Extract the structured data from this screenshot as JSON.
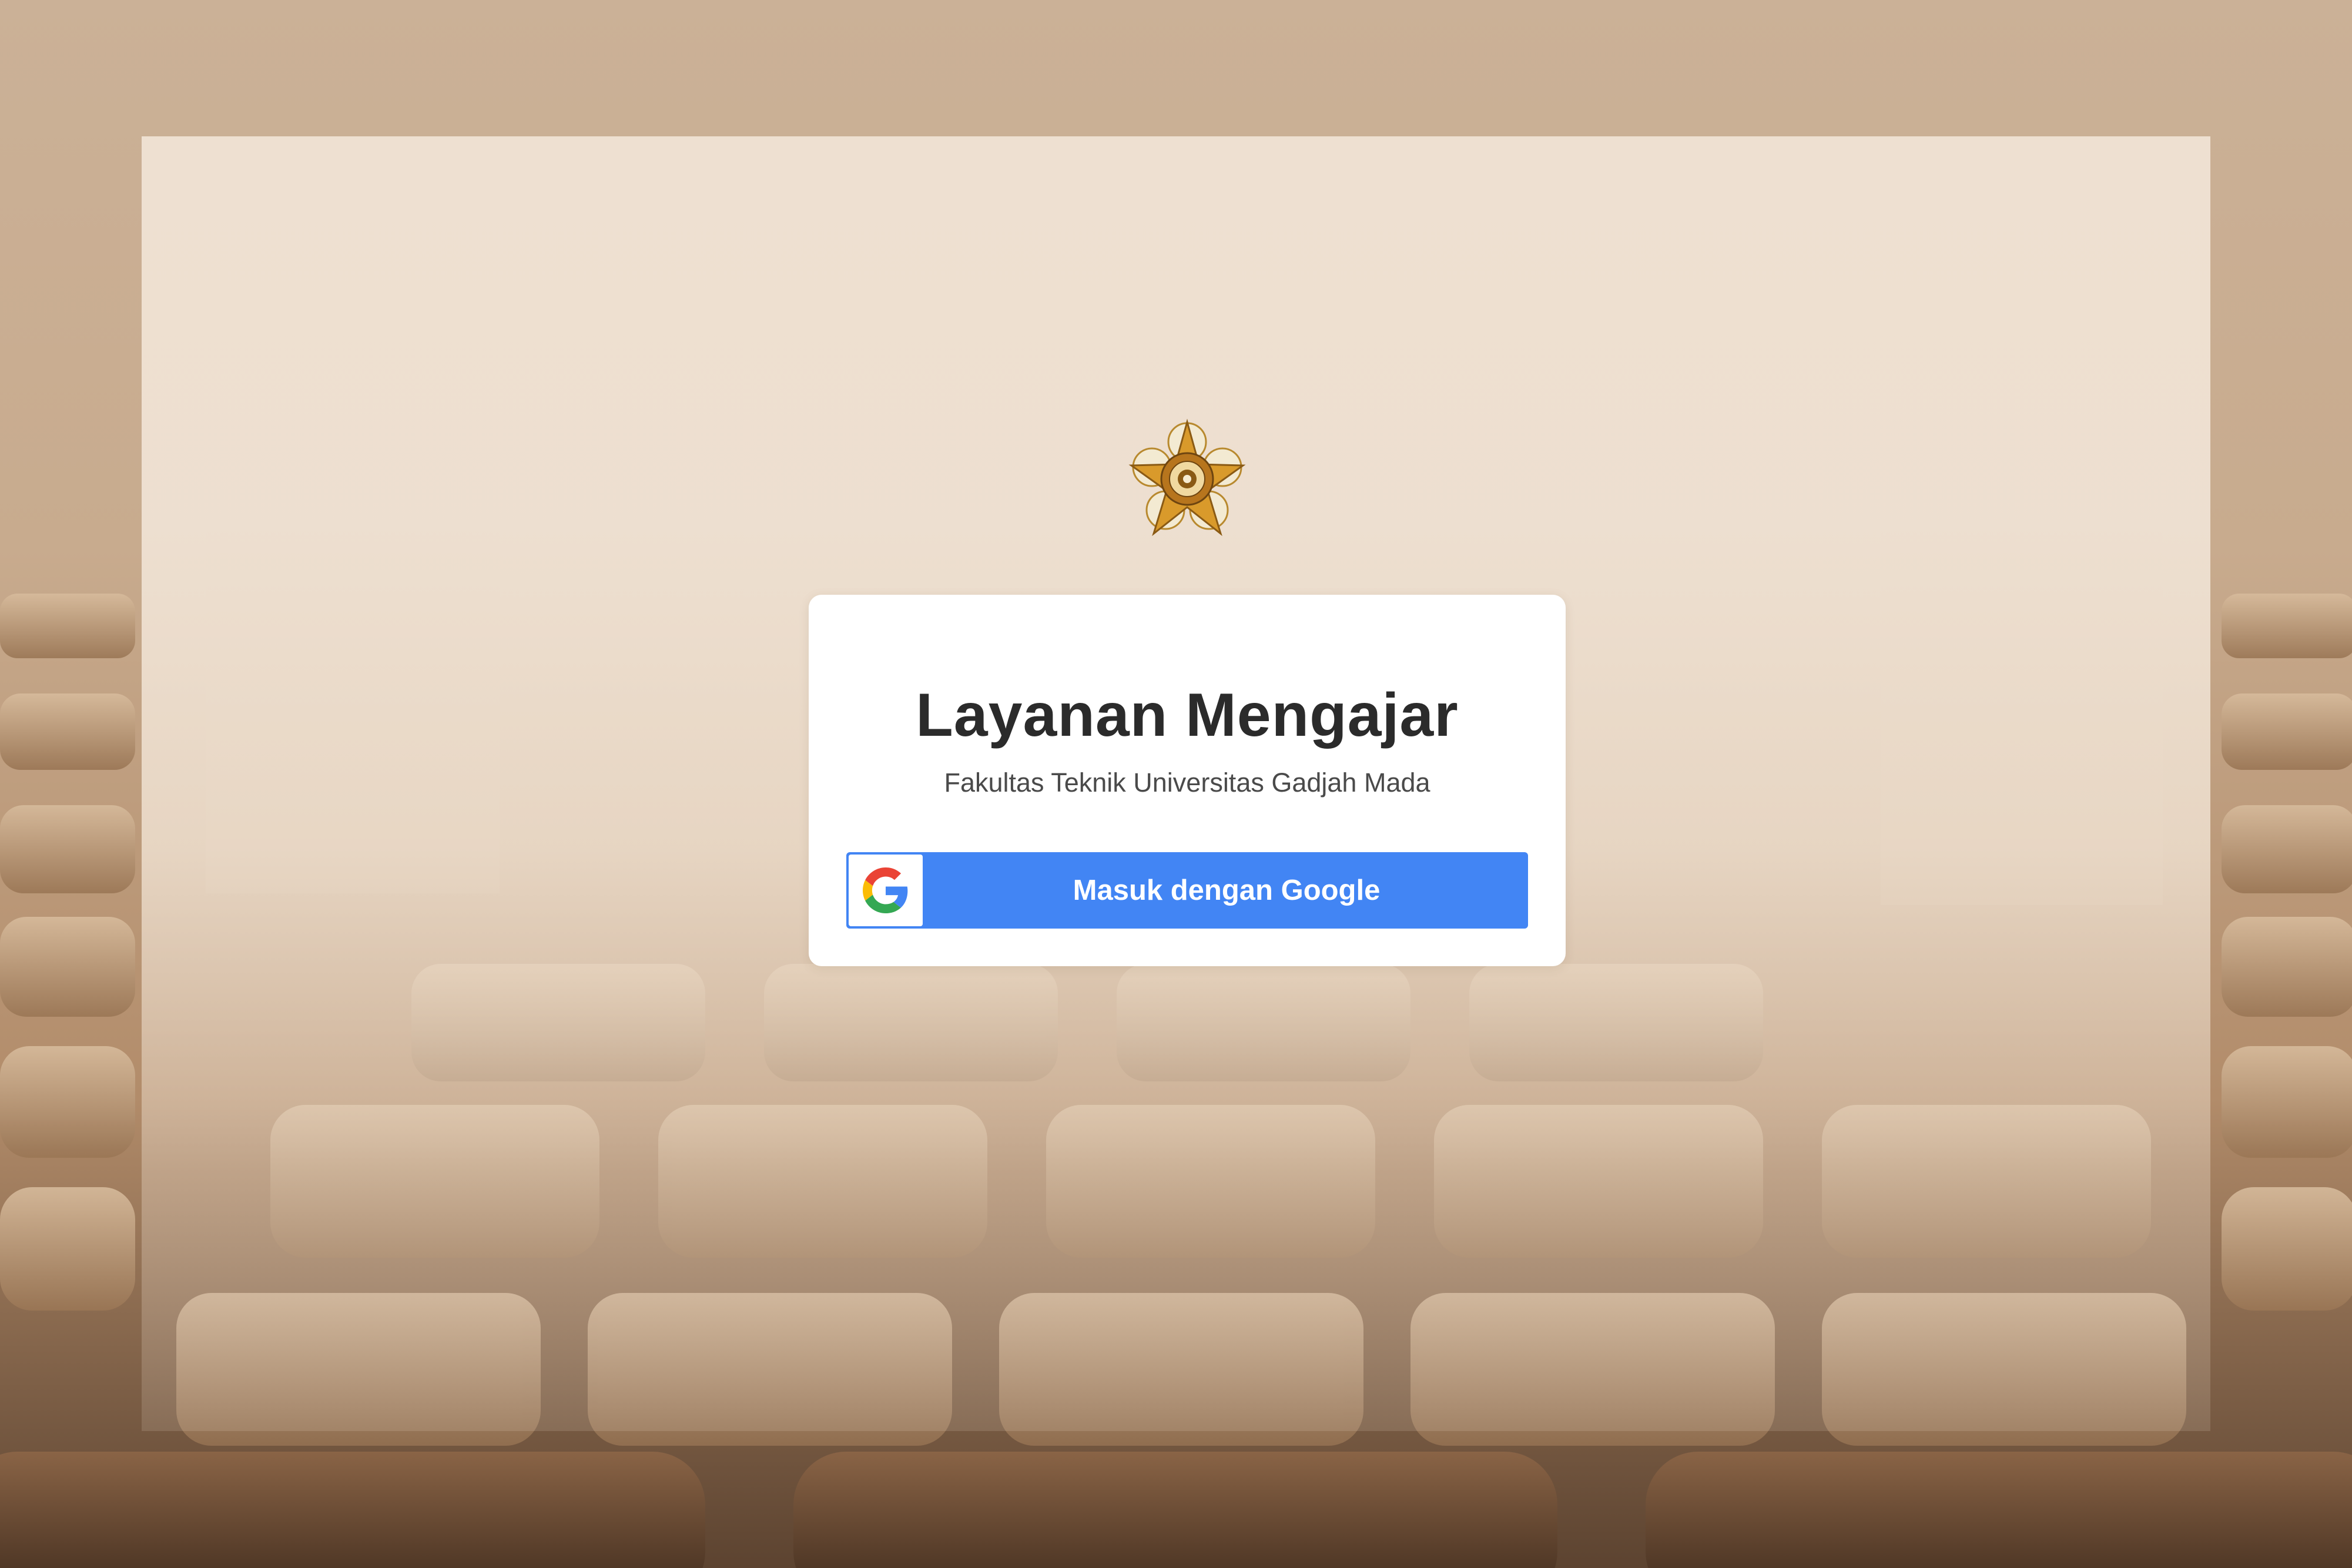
{
  "login": {
    "title": "Layanan Mengajar",
    "subtitle": "Fakultas Teknik Universitas Gadjah Mada",
    "google_button_label": "Masuk dengan Google"
  },
  "icons": {
    "logo": "ugm-emblem-icon",
    "google": "google-g-icon"
  },
  "colors": {
    "google_button": "#4285f4",
    "card_background": "#ffffff",
    "title_text": "#2b2b2b",
    "page_background": "#c9ae94"
  }
}
